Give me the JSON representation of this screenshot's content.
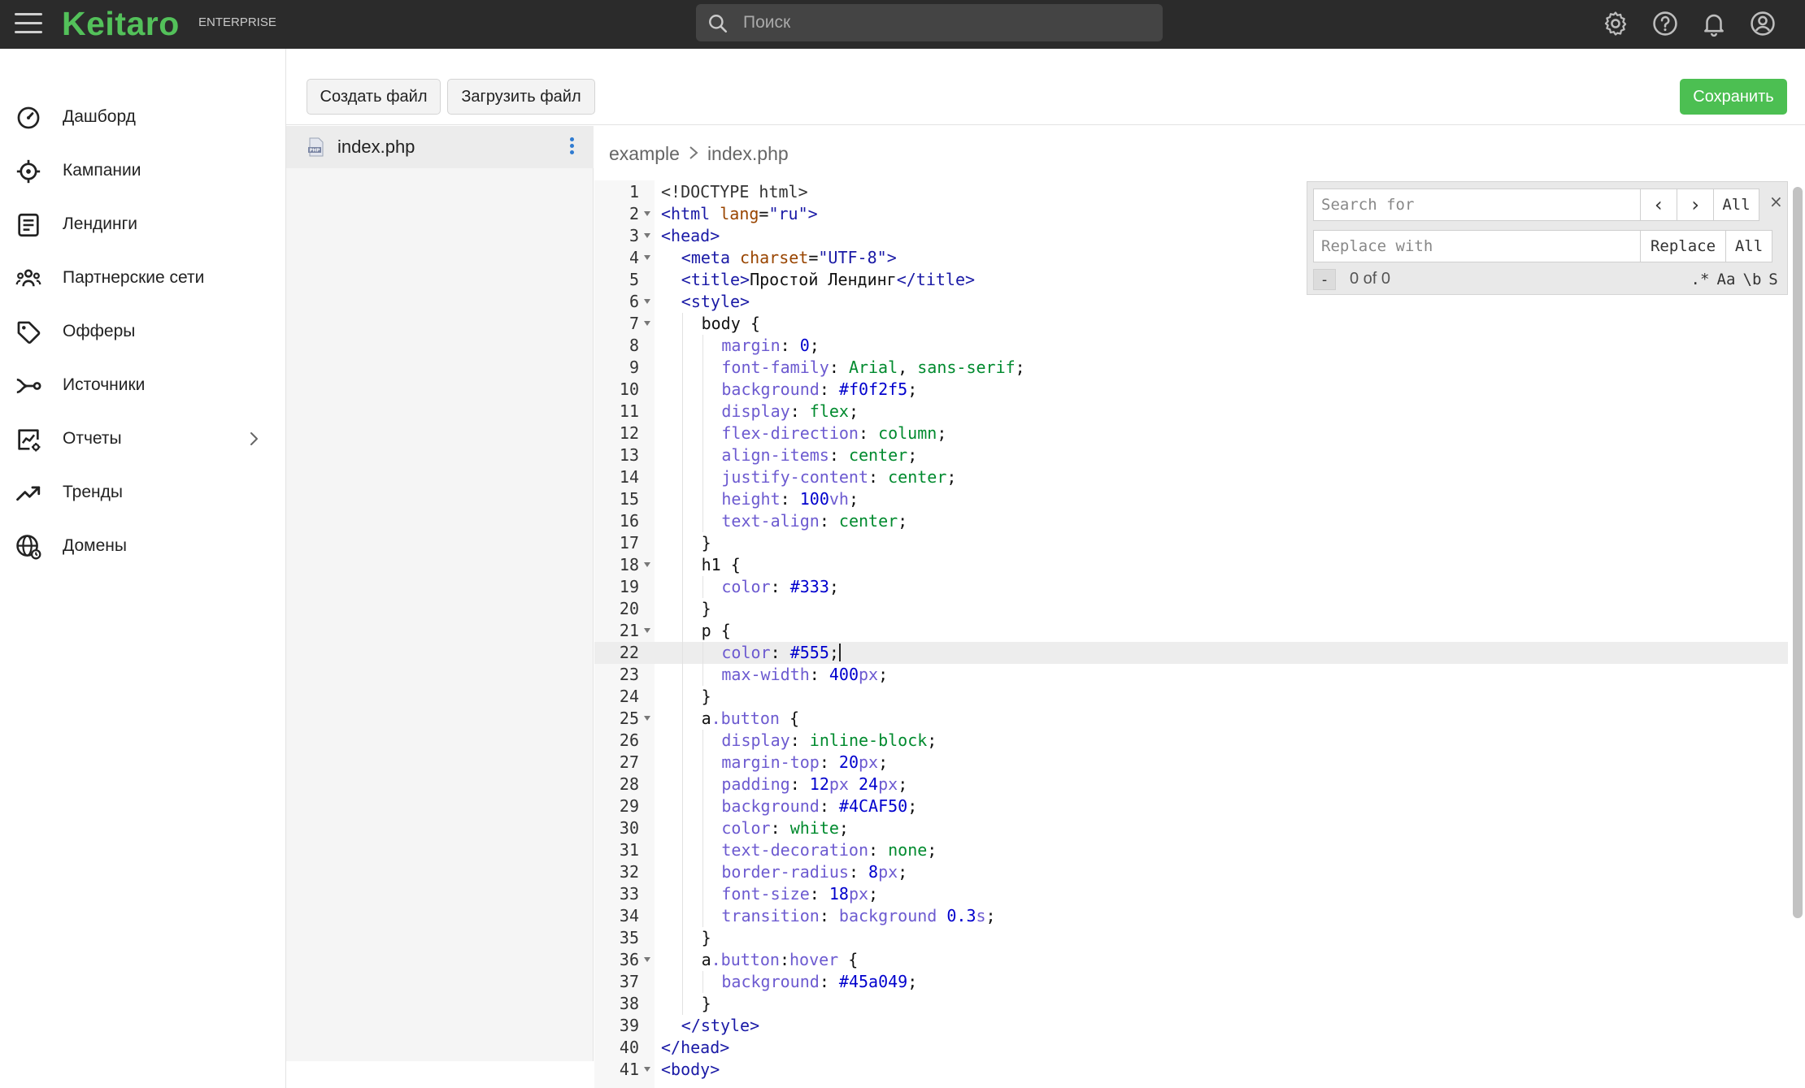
{
  "app": {
    "logo": "Keitaro",
    "edition": "ENTERPRISE",
    "search_placeholder": "Поиск"
  },
  "topbar_icons": [
    "gear-icon",
    "help-icon",
    "bell-icon",
    "account-icon"
  ],
  "sidebar": {
    "items": [
      {
        "label": "Дашборд",
        "icon": "dashboard-icon"
      },
      {
        "label": "Кампании",
        "icon": "campaigns-icon"
      },
      {
        "label": "Лендинги",
        "icon": "landings-icon"
      },
      {
        "label": "Партнерские сети",
        "icon": "partners-icon"
      },
      {
        "label": "Офферы",
        "icon": "offers-icon"
      },
      {
        "label": "Источники",
        "icon": "sources-icon"
      },
      {
        "label": "Отчеты",
        "icon": "reports-icon"
      },
      {
        "label": "Тренды",
        "icon": "trends-icon"
      },
      {
        "label": "Домены",
        "icon": "domains-icon"
      }
    ]
  },
  "toolbar": {
    "create_file": "Создать файл",
    "upload_file": "Загрузить файл",
    "save": "Сохранить"
  },
  "files": [
    {
      "name": "index.php"
    }
  ],
  "breadcrumb": {
    "folder": "example",
    "file": "index.php"
  },
  "find_replace": {
    "search_placeholder": "Search for",
    "replace_placeholder": "Replace with",
    "prev": "‹",
    "next": "›",
    "all": "All",
    "replace": "Replace",
    "replace_all": "All",
    "close": "×",
    "minus": "-",
    "counter": "0 of 0",
    "opt_regex": ".*",
    "opt_case": "Aa",
    "opt_word": "\\b",
    "opt_selection": "S"
  },
  "colors": {
    "accent": "#4cbf52",
    "topbar": "#2b2b2b",
    "logo": "#53c15a"
  },
  "editor": {
    "active_line": 22,
    "lines": [
      {
        "n": "1",
        "fold": false,
        "indent": 0,
        "tokens": [
          [
            "dt",
            "<!DOCTYPE html>"
          ]
        ]
      },
      {
        "n": "2",
        "fold": true,
        "indent": 0,
        "tokens": [
          [
            "tag",
            "<html "
          ],
          [
            "attr",
            "lang"
          ],
          [
            "pl",
            "="
          ],
          [
            "str",
            "\"ru\""
          ],
          [
            "tag",
            ">"
          ]
        ]
      },
      {
        "n": "3",
        "fold": true,
        "indent": 0,
        "tokens": [
          [
            "tag",
            "<head>"
          ]
        ]
      },
      {
        "n": "4",
        "fold": true,
        "indent": 1,
        "tokens": [
          [
            "tag",
            "<meta "
          ],
          [
            "attr",
            "charset"
          ],
          [
            "pl",
            "="
          ],
          [
            "str",
            "\"UTF-8\""
          ],
          [
            "tag",
            ">"
          ]
        ]
      },
      {
        "n": "5",
        "fold": false,
        "indent": 1,
        "tokens": [
          [
            "tag",
            "<title>"
          ],
          [
            "pl",
            "Простой Лендинг"
          ],
          [
            "tag",
            "</title>"
          ]
        ]
      },
      {
        "n": "6",
        "fold": true,
        "indent": 1,
        "tokens": [
          [
            "tag",
            "<style>"
          ]
        ]
      },
      {
        "n": "7",
        "fold": true,
        "indent": 2,
        "tokens": [
          [
            "sel",
            "body "
          ],
          [
            "pl",
            "{"
          ]
        ]
      },
      {
        "n": "8",
        "fold": false,
        "indent": 3,
        "tokens": [
          [
            "prop",
            "margin"
          ],
          [
            "pl",
            ": "
          ],
          [
            "num",
            "0"
          ],
          [
            "pl",
            ";"
          ]
        ]
      },
      {
        "n": "9",
        "fold": false,
        "indent": 3,
        "tokens": [
          [
            "prop",
            "font-family"
          ],
          [
            "pl",
            ": "
          ],
          [
            "kw",
            "Arial"
          ],
          [
            "pl",
            ", "
          ],
          [
            "kw",
            "sans-serif"
          ],
          [
            "pl",
            ";"
          ]
        ]
      },
      {
        "n": "10",
        "fold": false,
        "indent": 3,
        "tokens": [
          [
            "prop",
            "background"
          ],
          [
            "pl",
            ": "
          ],
          [
            "num",
            "#f0f2f5"
          ],
          [
            "pl",
            ";"
          ]
        ]
      },
      {
        "n": "11",
        "fold": false,
        "indent": 3,
        "tokens": [
          [
            "prop",
            "display"
          ],
          [
            "pl",
            ": "
          ],
          [
            "kw",
            "flex"
          ],
          [
            "pl",
            ";"
          ]
        ]
      },
      {
        "n": "12",
        "fold": false,
        "indent": 3,
        "tokens": [
          [
            "prop",
            "flex-direction"
          ],
          [
            "pl",
            ": "
          ],
          [
            "kw",
            "column"
          ],
          [
            "pl",
            ";"
          ]
        ]
      },
      {
        "n": "13",
        "fold": false,
        "indent": 3,
        "tokens": [
          [
            "prop",
            "align-items"
          ],
          [
            "pl",
            ": "
          ],
          [
            "kw",
            "center"
          ],
          [
            "pl",
            ";"
          ]
        ]
      },
      {
        "n": "14",
        "fold": false,
        "indent": 3,
        "tokens": [
          [
            "prop",
            "justify-content"
          ],
          [
            "pl",
            ": "
          ],
          [
            "kw",
            "center"
          ],
          [
            "pl",
            ";"
          ]
        ]
      },
      {
        "n": "15",
        "fold": false,
        "indent": 3,
        "tokens": [
          [
            "prop",
            "height"
          ],
          [
            "pl",
            ": "
          ],
          [
            "num",
            "100"
          ],
          [
            "prop",
            "vh"
          ],
          [
            "pl",
            ";"
          ]
        ]
      },
      {
        "n": "16",
        "fold": false,
        "indent": 3,
        "tokens": [
          [
            "prop",
            "text-align"
          ],
          [
            "pl",
            ": "
          ],
          [
            "kw",
            "center"
          ],
          [
            "pl",
            ";"
          ]
        ]
      },
      {
        "n": "17",
        "fold": false,
        "indent": 2,
        "tokens": [
          [
            "pl",
            "}"
          ]
        ]
      },
      {
        "n": "18",
        "fold": true,
        "indent": 2,
        "tokens": [
          [
            "sel",
            "h1 "
          ],
          [
            "pl",
            "{"
          ]
        ]
      },
      {
        "n": "19",
        "fold": false,
        "indent": 3,
        "tokens": [
          [
            "prop",
            "color"
          ],
          [
            "pl",
            ": "
          ],
          [
            "num",
            "#333"
          ],
          [
            "pl",
            ";"
          ]
        ]
      },
      {
        "n": "20",
        "fold": false,
        "indent": 2,
        "tokens": [
          [
            "pl",
            "}"
          ]
        ]
      },
      {
        "n": "21",
        "fold": true,
        "indent": 2,
        "tokens": [
          [
            "sel",
            "p "
          ],
          [
            "pl",
            "{"
          ]
        ]
      },
      {
        "n": "22",
        "fold": false,
        "indent": 3,
        "tokens": [
          [
            "prop",
            "color"
          ],
          [
            "pl",
            ": "
          ],
          [
            "num",
            "#555"
          ],
          [
            "pl",
            ";"
          ]
        ]
      },
      {
        "n": "23",
        "fold": false,
        "indent": 3,
        "tokens": [
          [
            "prop",
            "max-width"
          ],
          [
            "pl",
            ": "
          ],
          [
            "num",
            "400"
          ],
          [
            "prop",
            "px"
          ],
          [
            "pl",
            ";"
          ]
        ]
      },
      {
        "n": "24",
        "fold": false,
        "indent": 2,
        "tokens": [
          [
            "pl",
            "}"
          ]
        ]
      },
      {
        "n": "25",
        "fold": true,
        "indent": 2,
        "tokens": [
          [
            "sel",
            "a"
          ],
          [
            "prop",
            ".button"
          ],
          [
            "pl",
            " {"
          ]
        ]
      },
      {
        "n": "26",
        "fold": false,
        "indent": 3,
        "tokens": [
          [
            "prop",
            "display"
          ],
          [
            "pl",
            ": "
          ],
          [
            "kw",
            "inline-block"
          ],
          [
            "pl",
            ";"
          ]
        ]
      },
      {
        "n": "27",
        "fold": false,
        "indent": 3,
        "tokens": [
          [
            "prop",
            "margin-top"
          ],
          [
            "pl",
            ": "
          ],
          [
            "num",
            "20"
          ],
          [
            "prop",
            "px"
          ],
          [
            "pl",
            ";"
          ]
        ]
      },
      {
        "n": "28",
        "fold": false,
        "indent": 3,
        "tokens": [
          [
            "prop",
            "padding"
          ],
          [
            "pl",
            ": "
          ],
          [
            "num",
            "12"
          ],
          [
            "prop",
            "px"
          ],
          [
            "pl",
            " "
          ],
          [
            "num",
            "24"
          ],
          [
            "prop",
            "px"
          ],
          [
            "pl",
            ";"
          ]
        ]
      },
      {
        "n": "29",
        "fold": false,
        "indent": 3,
        "tokens": [
          [
            "prop",
            "background"
          ],
          [
            "pl",
            ": "
          ],
          [
            "num",
            "#4CAF50"
          ],
          [
            "pl",
            ";"
          ]
        ]
      },
      {
        "n": "30",
        "fold": false,
        "indent": 3,
        "tokens": [
          [
            "prop",
            "color"
          ],
          [
            "pl",
            ": "
          ],
          [
            "kw",
            "white"
          ],
          [
            "pl",
            ";"
          ]
        ]
      },
      {
        "n": "31",
        "fold": false,
        "indent": 3,
        "tokens": [
          [
            "prop",
            "text-decoration"
          ],
          [
            "pl",
            ": "
          ],
          [
            "kw",
            "none"
          ],
          [
            "pl",
            ";"
          ]
        ]
      },
      {
        "n": "32",
        "fold": false,
        "indent": 3,
        "tokens": [
          [
            "prop",
            "border-radius"
          ],
          [
            "pl",
            ": "
          ],
          [
            "num",
            "8"
          ],
          [
            "prop",
            "px"
          ],
          [
            "pl",
            ";"
          ]
        ]
      },
      {
        "n": "33",
        "fold": false,
        "indent": 3,
        "tokens": [
          [
            "prop",
            "font-size"
          ],
          [
            "pl",
            ": "
          ],
          [
            "num",
            "18"
          ],
          [
            "prop",
            "px"
          ],
          [
            "pl",
            ";"
          ]
        ]
      },
      {
        "n": "34",
        "fold": false,
        "indent": 3,
        "tokens": [
          [
            "prop",
            "transition"
          ],
          [
            "pl",
            ": "
          ],
          [
            "prop",
            "background"
          ],
          [
            "pl",
            " "
          ],
          [
            "num",
            "0.3"
          ],
          [
            "prop",
            "s"
          ],
          [
            "pl",
            ";"
          ]
        ]
      },
      {
        "n": "35",
        "fold": false,
        "indent": 2,
        "tokens": [
          [
            "pl",
            "}"
          ]
        ]
      },
      {
        "n": "36",
        "fold": true,
        "indent": 2,
        "tokens": [
          [
            "sel",
            "a"
          ],
          [
            "prop",
            ".button"
          ],
          [
            "pl",
            ":"
          ],
          [
            "prop",
            "hover"
          ],
          [
            "pl",
            " {"
          ]
        ]
      },
      {
        "n": "37",
        "fold": false,
        "indent": 3,
        "tokens": [
          [
            "prop",
            "background"
          ],
          [
            "pl",
            ": "
          ],
          [
            "num",
            "#45a049"
          ],
          [
            "pl",
            ";"
          ]
        ]
      },
      {
        "n": "38",
        "fold": false,
        "indent": 2,
        "tokens": [
          [
            "pl",
            "}"
          ]
        ]
      },
      {
        "n": "39",
        "fold": false,
        "indent": 1,
        "tokens": [
          [
            "tag",
            "</style>"
          ]
        ]
      },
      {
        "n": "40",
        "fold": false,
        "indent": 0,
        "tokens": [
          [
            "tag",
            "</head>"
          ]
        ]
      },
      {
        "n": "41",
        "fold": true,
        "indent": 0,
        "tokens": [
          [
            "tag",
            "<body>"
          ]
        ]
      }
    ]
  }
}
